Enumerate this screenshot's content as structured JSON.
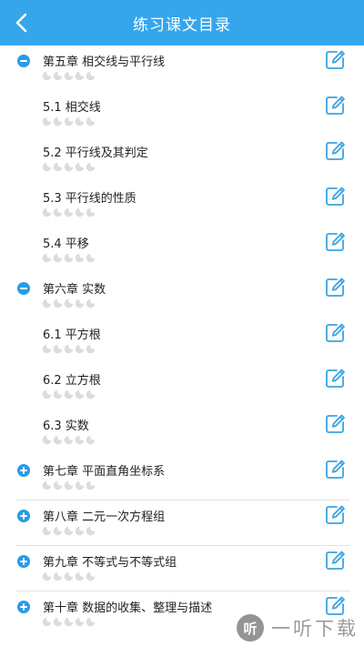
{
  "header": {
    "title": "练习课文目录"
  },
  "colors": {
    "header_bg": "#35a6ec",
    "accent": "#2a9be6",
    "icon": "#3aa3e3"
  },
  "rows": [
    {
      "title": "第五章 相交线与平行线",
      "kind": "chapter",
      "expanded": true,
      "stars": 0,
      "stars_total": 5
    },
    {
      "title": "5.1 相交线",
      "kind": "section",
      "stars": 0,
      "stars_total": 5
    },
    {
      "title": "5.2 平行线及其判定",
      "kind": "section",
      "stars": 0,
      "stars_total": 5
    },
    {
      "title": "5.3 平行线的性质",
      "kind": "section",
      "stars": 0,
      "stars_total": 5
    },
    {
      "title": "5.4 平移",
      "kind": "section",
      "stars": 0,
      "stars_total": 5
    },
    {
      "title": "第六章 实数",
      "kind": "chapter",
      "expanded": true,
      "stars": 0,
      "stars_total": 5
    },
    {
      "title": "6.1 平方根",
      "kind": "section",
      "stars": 0,
      "stars_total": 5
    },
    {
      "title": "6.2 立方根",
      "kind": "section",
      "stars": 0,
      "stars_total": 5
    },
    {
      "title": "6.3 实数",
      "kind": "section",
      "stars": 0,
      "stars_total": 5
    },
    {
      "title": "第七章 平面直角坐标系",
      "kind": "chapter",
      "expanded": false,
      "stars": 0,
      "stars_total": 5
    },
    {
      "title": "第八章 二元一次方程组",
      "kind": "chapter",
      "expanded": false,
      "stars": 0,
      "stars_total": 5
    },
    {
      "title": "第九章 不等式与不等式组",
      "kind": "chapter",
      "expanded": false,
      "stars": 0,
      "stars_total": 5
    },
    {
      "title": "第十章 数据的收集、整理与描述",
      "kind": "chapter",
      "expanded": false,
      "stars": 0,
      "stars_total": 5
    }
  ],
  "watermark": {
    "badge": "听",
    "text": "一听下载"
  }
}
